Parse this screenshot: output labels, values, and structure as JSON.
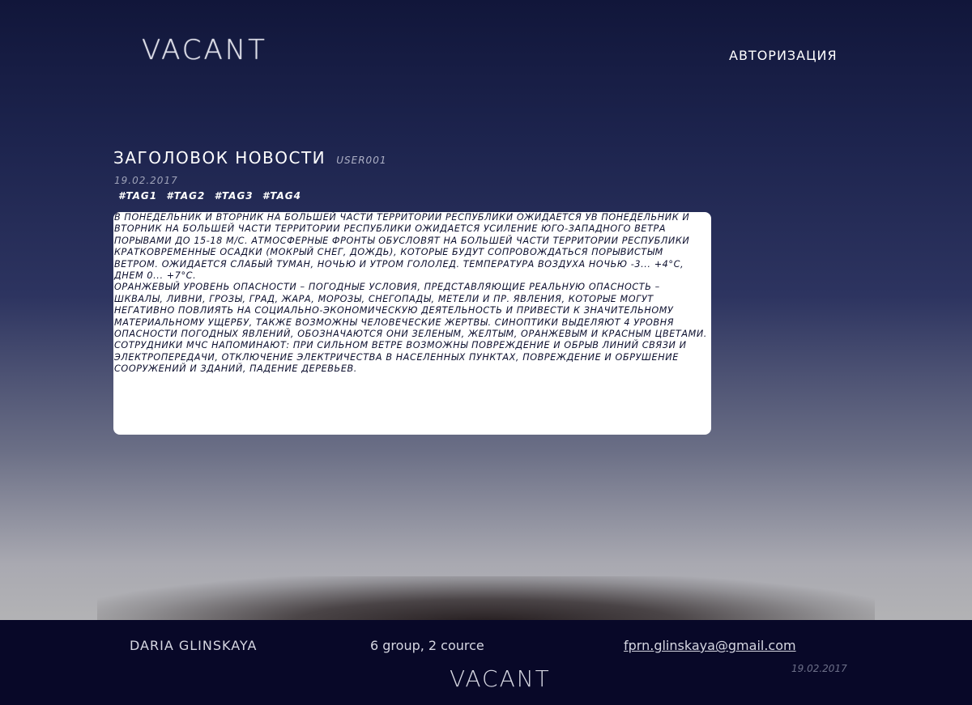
{
  "header": {
    "logo": "VACANT",
    "auth_link": "Авторизация"
  },
  "news": {
    "title": "Заголовок новости",
    "author": "user001",
    "date": "19.02.2017",
    "tags": [
      "#tag1",
      "#tag2",
      "#tag3",
      "#tag4"
    ],
    "paragraphs": [
      "В понедельник и вторник на большей части территории республики ожидается ув понедельник и вторник на большей части территории республики ожидается усиление юго-западного ветра порывами до 15-18 м/с. Атмосферные фронты обусловят на большей части территории республики кратковременные осадки (мокрый снег, дождь), которые будут сопровождаться порывистым ветром. Ожидается слабый туман, ночью и утром гололед. Температура воздуха ночью -3... +4°С, днем 0... +7°С.",
      "Оранжевый уровень опасности – погодные условия, представляющие реальную опасность – шквалы, ливни, грозы, град, жара, морозы, снегопады, метели и пр. явления, которые могут негативно повлиять на социально-экономическую деятельность и привести к значительному материальному ущербу, также возможны человеческие жертвы. Синоптики выделяют 4 уровня опасности погодных явлений, обозначаются они зеленым, желтым, оранжевым и красным цветами.",
      "Сотрудники МЧС напоминают: при сильном ветре возможны повреждение и обрыв линий связи и электропередачи, отключение электричества в населенных пунктах, повреждение и обрушение сооружений и зданий, падение деревьев."
    ]
  },
  "footer": {
    "name": "Daria Glinskaya",
    "group": "6 group, 2 cource",
    "email": "fprn.glinskaya@gmail.com",
    "logo": "VACANT",
    "date": "19.02.2017"
  },
  "colors": {
    "background_top": "#11163a",
    "background_bottom": "#b3b3b5",
    "footer_bg": "#080828",
    "content_bg": "#ffffff",
    "content_text": "#0c0f2e"
  }
}
